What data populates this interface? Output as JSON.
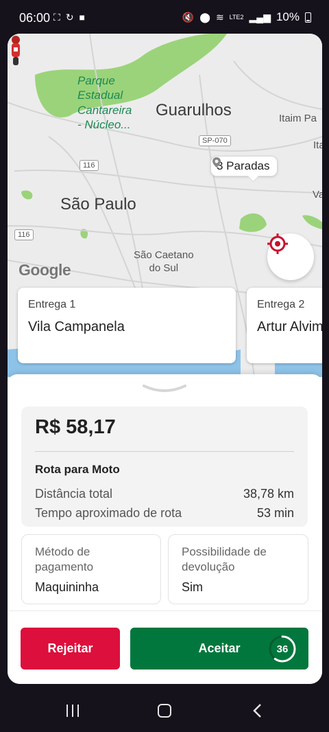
{
  "status_bar": {
    "time": "06:00",
    "network": "LTE2",
    "battery": "10%"
  },
  "map": {
    "labels": {
      "park": "Parque\nEstadual\nCantareira\n- Núcleo...",
      "guarulhos": "Guarulhos",
      "itaim": "Itaim Pa",
      "ita": "Ita",
      "va": "Va",
      "sao_paulo": "São Paulo",
      "sao_caetano": "São Caetano\ndo Sul"
    },
    "shields": {
      "sp070": "SP-070",
      "r116a": "116",
      "r116b": "116"
    },
    "google_logo": "Google",
    "stops_chip": "3 Paradas"
  },
  "deliveries": [
    {
      "label": "Entrega 1",
      "name": "Vila Campanela"
    },
    {
      "label": "Entrega 2",
      "name": "Artur Alvim"
    }
  ],
  "summary": {
    "price": "R$ 58,17",
    "route_title": "Rota para Moto",
    "distance_label": "Distância total",
    "distance_value": "38,78 km",
    "time_label": "Tempo aproximado de rota",
    "time_value": "53 min"
  },
  "payment": {
    "label": "Método de\npagamento",
    "value": "Maquininha"
  },
  "return": {
    "label": "Possibilidade de\ndevolução",
    "value": "Sim"
  },
  "actions": {
    "reject": "Rejeitar",
    "accept": "Aceitar",
    "countdown": "36",
    "countdown_fraction": 0.6
  },
  "colors": {
    "reject": "#dd0f3c",
    "accept": "#02773d",
    "locate": "#c8102e",
    "park_green": "#9bd37a"
  }
}
